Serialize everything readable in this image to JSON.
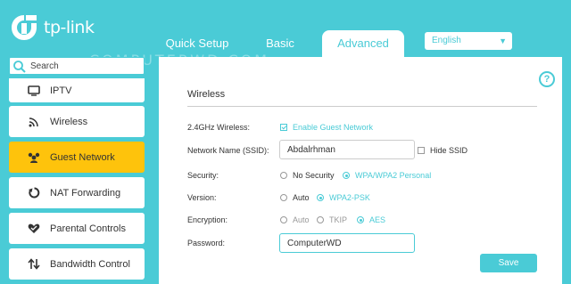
{
  "brand": {
    "name": "tp-link",
    "accent": "#4acbd6",
    "active": "#fec30c"
  },
  "watermark": "COMPUTERWD.COM",
  "nav": {
    "tabs": [
      {
        "label": "Quick Setup"
      },
      {
        "label": "Basic"
      },
      {
        "label": "Advanced"
      }
    ]
  },
  "language": {
    "selected": "English"
  },
  "search": {
    "placeholder": "Search"
  },
  "sidebar": {
    "items": [
      {
        "label": "IPTV",
        "icon": "monitor-icon"
      },
      {
        "label": "Wireless",
        "icon": "wifi-icon"
      },
      {
        "label": "Guest Network",
        "icon": "users-icon",
        "active": true
      },
      {
        "label": "NAT Forwarding",
        "icon": "refresh-icon"
      },
      {
        "label": "Parental Controls",
        "icon": "heart-icon"
      },
      {
        "label": "Bandwidth Control",
        "icon": "arrows-icon"
      }
    ]
  },
  "main": {
    "help": "?",
    "section_title": "Wireless",
    "fields": {
      "wireless_label": "2.4GHz Wireless:",
      "enable_guest": "Enable Guest Network",
      "ssid_label": "Network Name (SSID):",
      "ssid_value": "Abdalrhman",
      "hide_ssid": "Hide SSID",
      "security_label": "Security:",
      "security_options": [
        "No Security",
        "WPA/WPA2 Personal"
      ],
      "version_label": "Version:",
      "version_options": [
        "Auto",
        "WPA2-PSK"
      ],
      "encryption_label": "Encryption:",
      "encryption_options": [
        "Auto",
        "TKIP",
        "AES"
      ],
      "password_label": "Password:",
      "password_value": "ComputerWD"
    },
    "save_label": "Save"
  }
}
